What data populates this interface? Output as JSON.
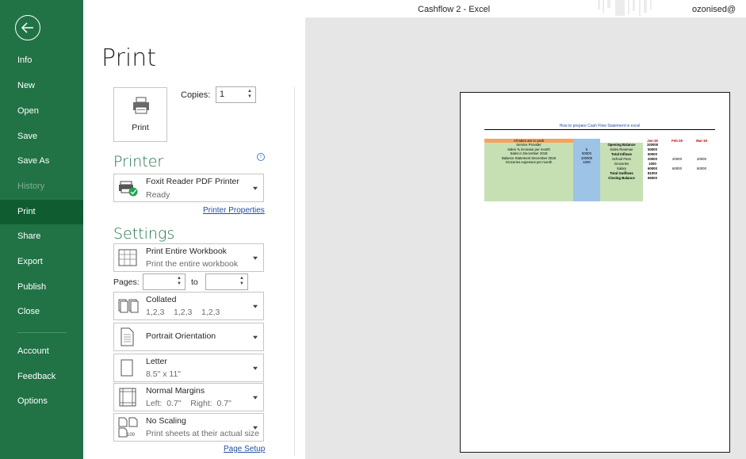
{
  "window": {
    "title": "Cashflow 2  -  Excel",
    "user": "ozonised@"
  },
  "sidebar": {
    "items": [
      {
        "label": "Info",
        "state": "normal"
      },
      {
        "label": "New",
        "state": "normal"
      },
      {
        "label": "Open",
        "state": "normal"
      },
      {
        "label": "Save",
        "state": "normal"
      },
      {
        "label": "Save As",
        "state": "normal"
      },
      {
        "label": "History",
        "state": "disabled"
      },
      {
        "label": "Print",
        "state": "active"
      },
      {
        "label": "Share",
        "state": "normal"
      },
      {
        "label": "Export",
        "state": "normal"
      },
      {
        "label": "Publish",
        "state": "normal"
      },
      {
        "label": "Close",
        "state": "normal"
      },
      {
        "label": "Account",
        "state": "normal"
      },
      {
        "label": "Feedback",
        "state": "normal"
      },
      {
        "label": "Options",
        "state": "normal"
      }
    ]
  },
  "print": {
    "heading": "Print",
    "button_label": "Print",
    "copies_label": "Copies:",
    "copies_value": "1"
  },
  "printer": {
    "heading": "Printer",
    "name": "Foxit Reader PDF Printer",
    "status": "Ready",
    "properties_link": "Printer Properties"
  },
  "settings": {
    "heading": "Settings",
    "what": {
      "title": "Print Entire Workbook",
      "subtitle": "Print the entire workbook"
    },
    "pages_label": "Pages:",
    "to_label": "to",
    "pages_from": "",
    "pages_to": "",
    "collation": {
      "title": "Collated",
      "subtitle": "1,2,3    1,2,3    1,2,3"
    },
    "orientation": {
      "title": "Portrait Orientation"
    },
    "paper": {
      "title": "Letter",
      "subtitle": "8.5\" x 11\""
    },
    "margins": {
      "title": "Normal Margins",
      "subtitle": "Left:  0.7\"    Right:  0.7\""
    },
    "scaling": {
      "title": "No Scaling",
      "subtitle": "Print sheets at their actual size",
      "icon_text": "100"
    },
    "page_setup_link": "Page Setup"
  },
  "preview": {
    "sheet_title": "How to prepare Cash Flow Statement in excel",
    "left_header": "All sales are in cash",
    "left_rows": [
      {
        "label": "Service Provider",
        "value": ""
      },
      {
        "label": "Sales % increase per month",
        "value": "6"
      },
      {
        "label": "Sales in December 2018",
        "value": "50000"
      },
      {
        "label": "Balance Statement December 2018",
        "value": "100000"
      },
      {
        "label": "Groceries expenses per month",
        "value": "1000"
      }
    ],
    "months": [
      "Jan-19",
      "Feb-19",
      "Mar-19"
    ],
    "right_rows": [
      {
        "label": "Opening Balance",
        "values": [
          "100000",
          "",
          ""
        ]
      },
      {
        "label": "Sales Revenue",
        "values": [
          "50000",
          "",
          ""
        ]
      },
      {
        "label": "Total Inflows",
        "values": [
          "50000",
          "",
          ""
        ]
      },
      {
        "label": "School Fees",
        "values": [
          "20000",
          "20000",
          "20000"
        ]
      },
      {
        "label": "Groceries",
        "values": [
          "1000",
          "",
          ""
        ]
      },
      {
        "label": "Salary",
        "values": [
          "60000",
          "60000",
          "60000"
        ]
      },
      {
        "label": "Total Outflows",
        "values": [
          "81000",
          "",
          ""
        ]
      },
      {
        "label": "Closing Balance",
        "values": [
          "69000",
          "",
          ""
        ]
      }
    ]
  },
  "colors": {
    "brand": "#217346",
    "active_nav": "#0e5c2f",
    "link": "#1f4e9d",
    "sheet_orange": "#f4a460",
    "sheet_green": "#c6e0b4",
    "sheet_blue": "#9dc3e6",
    "month_red": "#c00000"
  }
}
